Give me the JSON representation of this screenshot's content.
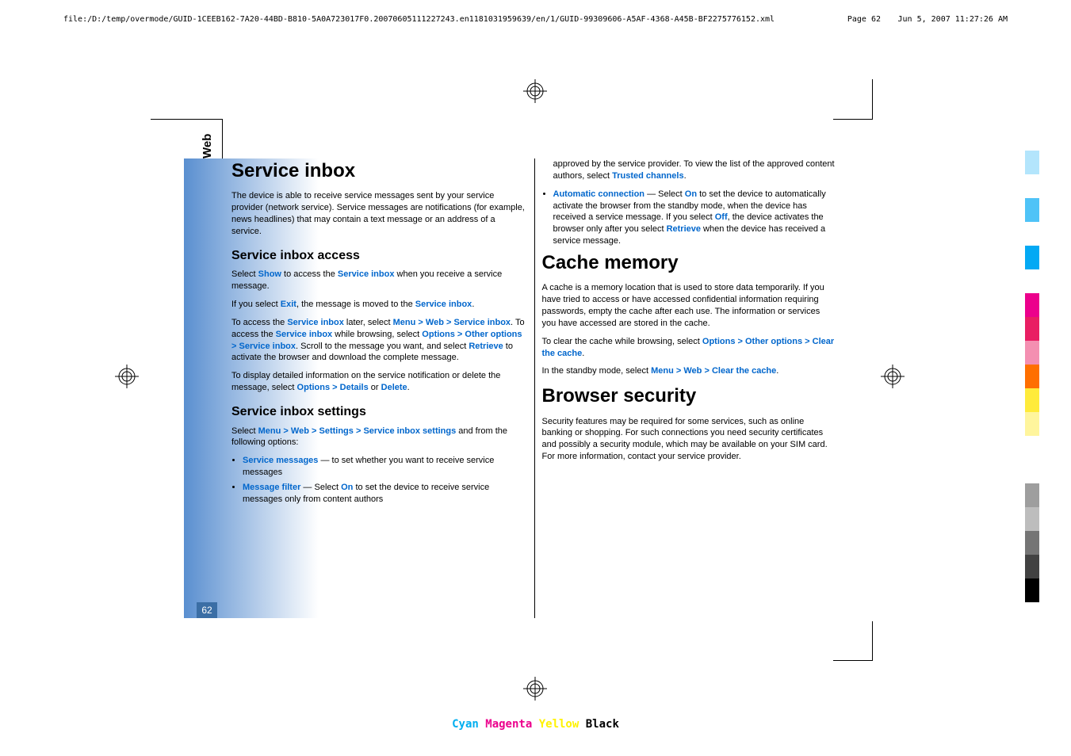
{
  "header": {
    "path": "file:/D:/temp/overmode/GUID-1CEEB162-7A20-44BD-B810-5A0A723017F0.20070605111227243.en1181031959639/en/1/GUID-99309606-A5AF-4368-A45B-BF2275776152.xml",
    "page": "Page  62",
    "date": "Jun 5, 2007 11:27:26 AM"
  },
  "side": {
    "label": "Web",
    "pagenum": "62"
  },
  "col1": {
    "h1": "Service inbox",
    "p1": "The device is able to receive service messages sent by your service provider (network service). Service messages are notifications (for example, news headlines) that may contain a text message or an address of a service.",
    "h2a": "Service inbox access",
    "p2a": "Select ",
    "lk1": "Show",
    "p2b": " to access the ",
    "lk2": "Service inbox",
    "p2c": " when you receive a service message.",
    "p3a": "If you select ",
    "lk3": "Exit",
    "p3b": ", the message is moved to the ",
    "lk4": "Service inbox",
    "p3c": ".",
    "p4a": "To access the ",
    "lk5": "Service inbox",
    "p4b": " later, select ",
    "lk6": "Menu",
    "lk7": "Web",
    "lk8": "Service inbox",
    "p4c": ". To access the ",
    "lk9": "Service inbox",
    "p4d": " while browsing, select ",
    "lk10": "Options",
    "lk11": "Other options",
    "lk12": "Service inbox",
    "p4e": ". Scroll to the message you want, and select ",
    "lk13": "Retrieve",
    "p4f": " to activate the browser and download the complete message.",
    "p5a": "To display detailed information on the service notification or delete the message, select ",
    "lk14": "Options",
    "lk15": "Details",
    "p5b": " or ",
    "lk16": "Delete",
    "p5c": ".",
    "h2b": "Service inbox settings",
    "p6a": "Select ",
    "lk17": "Menu",
    "lk18": "Web",
    "lk19": "Settings",
    "lk20": "Service inbox settings",
    "p6b": " and from the following options:",
    "li1a": "Service messages",
    "li1b": " — to set whether you want to receive service messages",
    "li2a": "Message filter",
    "li2b": " — Select ",
    "li2c": "On",
    "li2d": " to set the device to receive service messages only from content authors"
  },
  "col2": {
    "p0a": "approved by the service provider. To view the list of the approved content authors, select ",
    "lk0": "Trusted channels",
    "p0b": ".",
    "li3a": "Automatic connection",
    "li3b": " — Select ",
    "li3c": "On",
    "li3d": " to set the device to automatically activate the browser from the standby mode, when the device has received a service message. If you select ",
    "li3e": "Off",
    "li3f": ", the device activates the browser only after you select ",
    "li3g": "Retrieve",
    "li3h": " when the device has received a service message.",
    "h1a": "Cache memory",
    "p1": "A cache is a memory location that is used to store data temporarily. If you have tried to access or have accessed confidential information requiring passwords, empty the cache after each use. The information or services you have accessed are stored in the cache.",
    "p2a": "To clear the cache while browsing, select ",
    "lk1": "Options",
    "lk2": "Other options",
    "lk3": "Clear the cache",
    "p2b": ".",
    "p3a": "In the standby mode, select ",
    "lk4": "Menu",
    "lk5": "Web",
    "lk6": "Clear the cache",
    "p3b": ".",
    "h1b": "Browser security",
    "p4": "Security features may be required for some services, such as online banking or shopping. For such connections you need security certificates and possibly a security module, which may be available on your SIM card. For more information, contact your service provider."
  },
  "footer": {
    "cyan": "Cyan",
    "magenta": "Magenta",
    "yellow": "Yellow",
    "black": "Black"
  },
  "colorbar": [
    "#b3e5fc",
    "",
    "#4fc3f7",
    "",
    "#03a9f4",
    "",
    "#ec008c",
    "#e91e63",
    "#f48fb1",
    "#ff6f00",
    "#ffeb3b",
    "#fff59d",
    "",
    "",
    "#9e9e9e",
    "#bdbdbd",
    "#757575",
    "#424242",
    "#000"
  ]
}
